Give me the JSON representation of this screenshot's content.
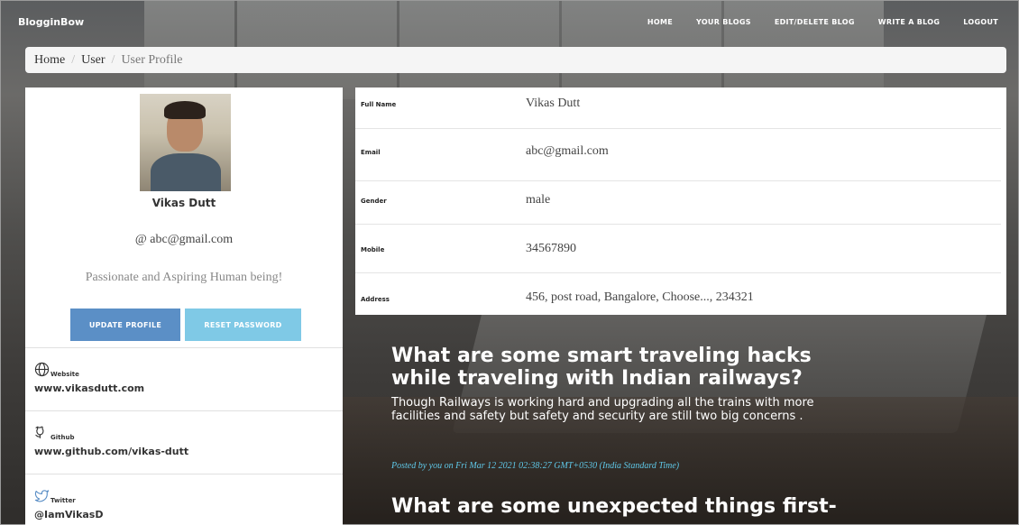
{
  "navbar": {
    "brand": "BlogginBow",
    "links": [
      "HOME",
      "YOUR BLOGS",
      "EDIT/DELETE BLOG",
      "WRITE A BLOG",
      "LOGOUT"
    ]
  },
  "breadcrumb": {
    "items": [
      "Home",
      "User",
      "User Profile"
    ]
  },
  "profile": {
    "name": "Vikas Dutt",
    "email": "@ abc@gmail.com",
    "bio": "Passionate and Aspiring Human being!",
    "update_label": "UPDATE PROFILE",
    "reset_label": "RESET PASSWORD",
    "social": {
      "website_label": "Website",
      "website_value": "www.vikasdutt.com",
      "github_label": "Github",
      "github_value": "www.github.com/vikas-dutt",
      "twitter_label": "Twitter",
      "twitter_value": "@IamVikasD"
    }
  },
  "info": {
    "rows": [
      {
        "label": "Full Name",
        "value": "Vikas Dutt"
      },
      {
        "label": "Email",
        "value": "abc@gmail.com"
      },
      {
        "label": "Gender",
        "value": "male"
      },
      {
        "label": "Mobile",
        "value": "34567890"
      },
      {
        "label": "Address",
        "value": "456, post road, Bangalore, Choose..., 234321"
      }
    ]
  },
  "posts": [
    {
      "title_line1": "What are some smart traveling hacks",
      "title_line2": "while traveling with Indian railways?",
      "excerpt": "Though Railways is working hard and upgrading all the trains with more facilities and safety but safety and security are still two big concerns .",
      "meta": "Posted by you on Fri Mar 12 2021 02:38:27 GMT+0530 (India Standard Time)"
    },
    {
      "title_line1": "What are some unexpected things first-"
    }
  ],
  "colors": {
    "update_button": "#5b8fc6",
    "reset_button": "#7fc9e6",
    "post_meta": "#5fc8e8"
  }
}
